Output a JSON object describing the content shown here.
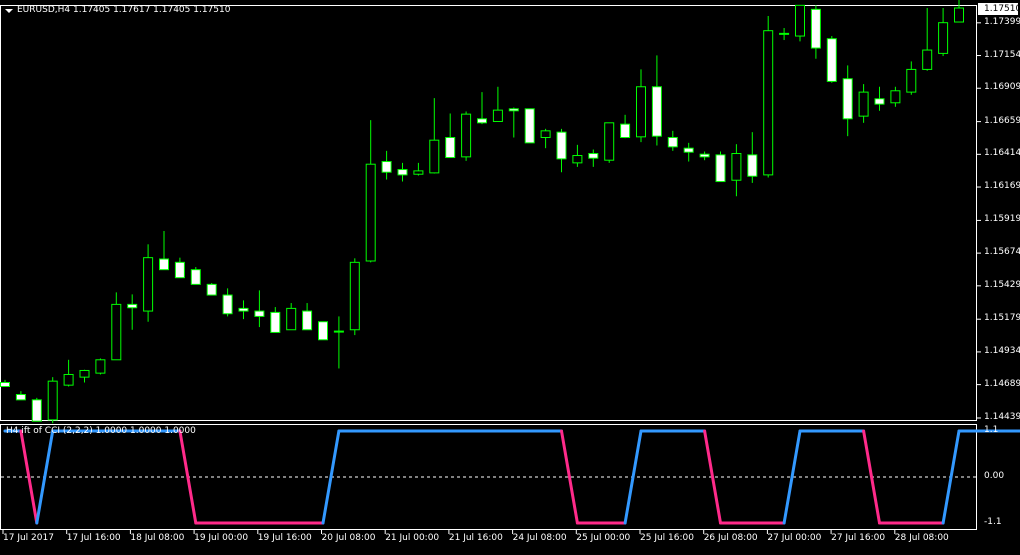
{
  "header": {
    "symbol": "EURUSD,H4",
    "ohlc": "1.17405 1.17617 1.17405 1.17510",
    "indicator_title": "H4 ift of CCI (2,2,2) 1.0000 1.0000 1.0000"
  },
  "colors": {
    "background": "#000000",
    "axis": "#ffffff",
    "bull_wick": "#00ff00",
    "bull_body": "#000000",
    "bear_body": "#ffffff",
    "indicator_up": "#3399ff",
    "indicator_down": "#ff2a8a",
    "zero_line": "#ffffff"
  },
  "price_axis": {
    "current": "1.17510",
    "labels": [
      "1.17399",
      "1.17154",
      "1.16909",
      "1.16659",
      "1.16414",
      "1.16169",
      "1.15919",
      "1.15674",
      "1.15429",
      "1.15179",
      "1.14934",
      "1.14689",
      "1.14439"
    ]
  },
  "indicator_axis": {
    "labels": [
      "1.1",
      "0.00",
      "-1.1"
    ]
  },
  "time_axis": {
    "labels": [
      "17 Jul 2017",
      "17 Jul 16:00",
      "18 Jul 08:00",
      "19 Jul 00:00",
      "19 Jul 16:00",
      "20 Jul 08:00",
      "21 Jul 00:00",
      "21 Jul 16:00",
      "24 Jul 08:00",
      "25 Jul 00:00",
      "25 Jul 16:00",
      "26 Jul 08:00",
      "27 Jul 00:00",
      "27 Jul 16:00",
      "28 Jul 08:00"
    ]
  },
  "chart_data": [
    {
      "type": "candlestick",
      "series_name": "EURUSD,H4",
      "ylim": [
        1.14439,
        1.1753
      ],
      "candles": [
        {
          "o": 1.14705,
          "h": 1.14725,
          "l": 1.14675,
          "c": 1.14675
        },
        {
          "o": 1.14615,
          "h": 1.1464,
          "l": 1.14585,
          "c": 1.14575
        },
        {
          "o": 1.14575,
          "h": 1.1459,
          "l": 1.1443,
          "c": 1.14415
        },
        {
          "o": 1.14425,
          "h": 1.14745,
          "l": 1.144,
          "c": 1.14715
        },
        {
          "o": 1.14685,
          "h": 1.14875,
          "l": 1.14675,
          "c": 1.14765
        },
        {
          "o": 1.14745,
          "h": 1.148,
          "l": 1.14705,
          "c": 1.14795
        },
        {
          "o": 1.14775,
          "h": 1.14885,
          "l": 1.14765,
          "c": 1.14875
        },
        {
          "o": 1.14875,
          "h": 1.1538,
          "l": 1.14875,
          "c": 1.1529
        },
        {
          "o": 1.1529,
          "h": 1.15365,
          "l": 1.151,
          "c": 1.15265
        },
        {
          "o": 1.1524,
          "h": 1.1574,
          "l": 1.1516,
          "c": 1.1564
        },
        {
          "o": 1.1563,
          "h": 1.1584,
          "l": 1.156,
          "c": 1.1555
        },
        {
          "o": 1.15605,
          "h": 1.1564,
          "l": 1.1549,
          "c": 1.1549
        },
        {
          "o": 1.1555,
          "h": 1.1557,
          "l": 1.15455,
          "c": 1.1544
        },
        {
          "o": 1.1544,
          "h": 1.1545,
          "l": 1.1536,
          "c": 1.1536
        },
        {
          "o": 1.1536,
          "h": 1.1541,
          "l": 1.152,
          "c": 1.1522
        },
        {
          "o": 1.1526,
          "h": 1.1532,
          "l": 1.1518,
          "c": 1.1524
        },
        {
          "o": 1.1524,
          "h": 1.15395,
          "l": 1.1512,
          "c": 1.152
        },
        {
          "o": 1.1523,
          "h": 1.1527,
          "l": 1.15085,
          "c": 1.1508
        },
        {
          "o": 1.151,
          "h": 1.153,
          "l": 1.151,
          "c": 1.1526
        },
        {
          "o": 1.1524,
          "h": 1.153,
          "l": 1.1512,
          "c": 1.151
        },
        {
          "o": 1.1516,
          "h": 1.1516,
          "l": 1.15035,
          "c": 1.15025
        },
        {
          "o": 1.1509,
          "h": 1.152,
          "l": 1.1481,
          "c": 1.1509
        },
        {
          "o": 1.151,
          "h": 1.15635,
          "l": 1.1506,
          "c": 1.15605
        },
        {
          "o": 1.15615,
          "h": 1.1667,
          "l": 1.15605,
          "c": 1.1634
        },
        {
          "o": 1.1636,
          "h": 1.1644,
          "l": 1.16225,
          "c": 1.1628
        },
        {
          "o": 1.163,
          "h": 1.1635,
          "l": 1.1621,
          "c": 1.1626
        },
        {
          "o": 1.16265,
          "h": 1.1635,
          "l": 1.16255,
          "c": 1.1629
        },
        {
          "o": 1.16275,
          "h": 1.16835,
          "l": 1.1627,
          "c": 1.1652
        },
        {
          "o": 1.1654,
          "h": 1.1672,
          "l": 1.16395,
          "c": 1.1639
        },
        {
          "o": 1.16395,
          "h": 1.16735,
          "l": 1.16365,
          "c": 1.16715
        },
        {
          "o": 1.1668,
          "h": 1.1688,
          "l": 1.1664,
          "c": 1.1665
        },
        {
          "o": 1.1666,
          "h": 1.1692,
          "l": 1.1666,
          "c": 1.16745
        },
        {
          "o": 1.16755,
          "h": 1.16765,
          "l": 1.1654,
          "c": 1.1674
        },
        {
          "o": 1.16755,
          "h": 1.16755,
          "l": 1.16515,
          "c": 1.165
        },
        {
          "o": 1.1654,
          "h": 1.16605,
          "l": 1.1646,
          "c": 1.1659
        },
        {
          "o": 1.1658,
          "h": 1.16605,
          "l": 1.1628,
          "c": 1.1638
        },
        {
          "o": 1.1635,
          "h": 1.16485,
          "l": 1.1632,
          "c": 1.16405
        },
        {
          "o": 1.1642,
          "h": 1.1645,
          "l": 1.1632,
          "c": 1.16385
        },
        {
          "o": 1.1637,
          "h": 1.166,
          "l": 1.1635,
          "c": 1.1665
        },
        {
          "o": 1.1664,
          "h": 1.1671,
          "l": 1.16535,
          "c": 1.1654
        },
        {
          "o": 1.16545,
          "h": 1.1705,
          "l": 1.16505,
          "c": 1.1692
        },
        {
          "o": 1.1692,
          "h": 1.17155,
          "l": 1.1648,
          "c": 1.1655
        },
        {
          "o": 1.1654,
          "h": 1.1659,
          "l": 1.1644,
          "c": 1.1647
        },
        {
          "o": 1.1646,
          "h": 1.165,
          "l": 1.1636,
          "c": 1.1643
        },
        {
          "o": 1.16415,
          "h": 1.16435,
          "l": 1.1637,
          "c": 1.16395
        },
        {
          "o": 1.1641,
          "h": 1.16435,
          "l": 1.1622,
          "c": 1.1621
        },
        {
          "o": 1.1622,
          "h": 1.1649,
          "l": 1.161,
          "c": 1.1642
        },
        {
          "o": 1.1641,
          "h": 1.1658,
          "l": 1.162,
          "c": 1.1625
        },
        {
          "o": 1.1626,
          "h": 1.1745,
          "l": 1.1624,
          "c": 1.1734
        },
        {
          "o": 1.1732,
          "h": 1.1736,
          "l": 1.1727,
          "c": 1.1732
        },
        {
          "o": 1.173,
          "h": 1.1753,
          "l": 1.1726,
          "c": 1.1753
        },
        {
          "o": 1.175,
          "h": 1.1753,
          "l": 1.1713,
          "c": 1.1721
        },
        {
          "o": 1.1728,
          "h": 1.173,
          "l": 1.1695,
          "c": 1.1696
        },
        {
          "o": 1.1698,
          "h": 1.1708,
          "l": 1.1655,
          "c": 1.1668
        },
        {
          "o": 1.167,
          "h": 1.1694,
          "l": 1.1665,
          "c": 1.1688
        },
        {
          "o": 1.1683,
          "h": 1.1692,
          "l": 1.1674,
          "c": 1.1679
        },
        {
          "o": 1.168,
          "h": 1.1692,
          "l": 1.1677,
          "c": 1.1689
        },
        {
          "o": 1.1688,
          "h": 1.1711,
          "l": 1.1686,
          "c": 1.1705
        },
        {
          "o": 1.1705,
          "h": 1.1751,
          "l": 1.1704,
          "c": 1.17195
        },
        {
          "o": 1.1717,
          "h": 1.1751,
          "l": 1.1715,
          "c": 1.174
        },
        {
          "o": 1.17405,
          "h": 1.17617,
          "l": 1.17405,
          "c": 1.1751
        }
      ]
    },
    {
      "type": "line",
      "series_name": "ift of CCI (2,2,2)",
      "ylim": [
        -1.1,
        1.1
      ],
      "levels": [
        0
      ],
      "values": [
        1,
        1,
        -1,
        1,
        1,
        1,
        1,
        1,
        1,
        1,
        1,
        1,
        -1,
        -1,
        -1,
        -1,
        -1,
        -1,
        -1,
        -1,
        -1,
        1,
        1,
        1,
        1,
        1,
        1,
        1,
        1,
        1,
        1,
        1,
        1,
        1,
        1,
        1,
        -1,
        -1,
        -1,
        -1,
        1,
        1,
        1,
        1,
        1,
        -1,
        -1,
        -1,
        -1,
        -1,
        1,
        1,
        1,
        1,
        1,
        -1,
        -1,
        -1,
        -1,
        -1,
        1,
        1,
        1,
        1,
        1,
        1
      ]
    }
  ]
}
